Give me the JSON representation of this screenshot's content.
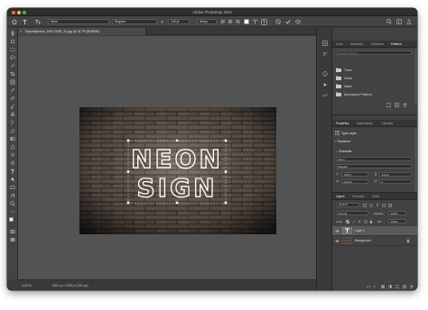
{
  "window": {
    "title": "Adobe Photoshop 2022"
  },
  "options_bar": {
    "tool_icon": "type-tool-icon",
    "orientation_icon": "text-orientation-icon",
    "font_family": "Neon",
    "font_style": "Regular",
    "font_size": "145 pt",
    "anti_alias": "Sharp",
    "share_label": "Share"
  },
  "document": {
    "tab_label": "Depositphotos_306174182_XL.jpg @ 16.7% (RGB/8#)",
    "close_label": "×",
    "neon_line1": "NEON",
    "neon_line2": "SIGN"
  },
  "status": {
    "zoom": "16.67%",
    "doc_size": "6000 px x 3338 px (300 ppi)"
  },
  "top_panel": {
    "tabs": [
      "Color",
      "Swatches",
      "Gradients",
      "Patterns"
    ],
    "active_tab": "Patterns",
    "search_placeholder": "Search Patterns",
    "folders": [
      "Trees",
      "Grass",
      "Water",
      "Apocalypse Patterns"
    ]
  },
  "properties_panel": {
    "tabs": [
      "Properties",
      "Adjustments",
      "Libraries"
    ],
    "layer_type": "Type Layer",
    "transform_label": "Transform",
    "character_label": "Character",
    "font_family": "Neon",
    "font_style": "Regular",
    "font_size": "145 pt",
    "leading": "133 pt",
    "kerning": "Metrics",
    "tracking": "0"
  },
  "layers_panel": {
    "tabs": [
      "Layers",
      "Channels",
      "Paths"
    ],
    "filter_label": "Kind",
    "blend_mode": "Normal",
    "opacity_label": "Opacity:",
    "opacity": "100%",
    "lock_label": "Lock:",
    "fill_label": "Fill:",
    "fill": "100%",
    "layers": [
      {
        "name": "Layer 1",
        "selected": true
      },
      {
        "name": "Background",
        "selected": false
      }
    ]
  },
  "colors": {
    "accent": "#2f7de1",
    "panel_bg": "#424242",
    "canvas_bg": "#535353"
  }
}
